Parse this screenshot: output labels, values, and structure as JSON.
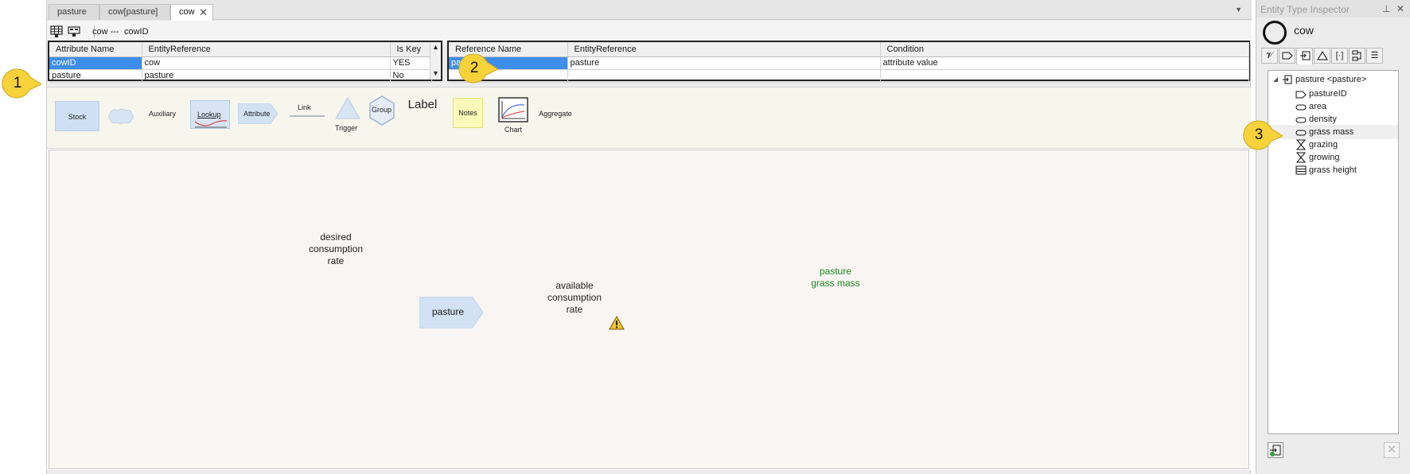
{
  "tabs": [
    {
      "label": "pasture"
    },
    {
      "label": "cow[pasture]"
    },
    {
      "label": "cow",
      "close": "✕"
    }
  ],
  "toolbar": {
    "crumb_entity": "cow ---",
    "crumb_attr": "cowID"
  },
  "attributes_grid": {
    "headers": [
      "Attribute Name",
      "EntityReference",
      "Is Key"
    ],
    "rows": [
      {
        "name": "cowID",
        "ref": "cow",
        "key": "YES"
      },
      {
        "name": "pasture",
        "ref": "pasture",
        "key": "No"
      }
    ]
  },
  "references_grid": {
    "headers": [
      "Reference Name",
      "EntityReference",
      "Condition"
    ],
    "rows": [
      {
        "name": "pasture",
        "ref": "pasture",
        "cond": "attribute value"
      },
      {
        "name": "",
        "ref": "",
        "cond": ""
      }
    ]
  },
  "palette": {
    "stock": "Stock",
    "auxiliary": "Auxiliary",
    "lookup": "Lookup",
    "attribute": "Attribute",
    "link": "Link",
    "trigger": "Trigger",
    "group": "Group",
    "label": "Label",
    "notes": "Notes",
    "chart": "Chart",
    "aggregate": "Aggregate"
  },
  "canvas": {
    "desired": [
      "desired",
      "consumption",
      "rate"
    ],
    "available": [
      "available",
      "consumption",
      "rate"
    ],
    "pasture_node": "pasture",
    "pasture_grass": [
      "pasture",
      "grass mass"
    ]
  },
  "inspector": {
    "title": "Entity Type Inspector",
    "entity_name": "cow",
    "tree_root": "pasture <pasture>",
    "tree_items": [
      {
        "label": "pastureID",
        "icon": "key-icon"
      },
      {
        "label": "area",
        "icon": "attribute-icon"
      },
      {
        "label": "density",
        "icon": "attribute-icon"
      },
      {
        "label": "grass mass",
        "icon": "attribute-icon"
      },
      {
        "label": "grazing",
        "icon": "flow-icon"
      },
      {
        "label": "growing",
        "icon": "flow-icon"
      },
      {
        "label": "grass height",
        "icon": "stock-icon"
      }
    ]
  },
  "callouts": [
    "1",
    "2",
    "3"
  ],
  "colors": {
    "selection": "#3d8ee8",
    "canvas_green": "#1e8a1e",
    "callout": "#f7d23a"
  }
}
